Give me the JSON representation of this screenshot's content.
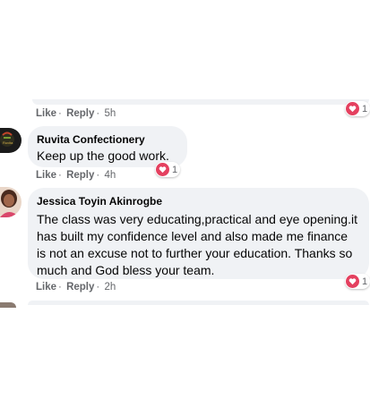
{
  "comments": [
    {
      "meta": {
        "like": "Like",
        "dot": "·",
        "reply": "Reply",
        "sep": "·",
        "time": "5h"
      },
      "reaction_count": "1"
    },
    {
      "author": "Ruvita Confectionery",
      "text": "Keep up the good work.",
      "meta": {
        "like": "Like",
        "dot": "·",
        "reply": "Reply",
        "sep": "·",
        "time": "4h"
      },
      "reaction_count": "1"
    },
    {
      "author": "Jessica Toyin Akinrogbe",
      "text": "The class was very educating,practical and eye opening.it has built my confidence level and also made me finance is not an excuse not to further your education. Thanks so much and God bless your team.",
      "meta": {
        "like": "Like",
        "dot": "·",
        "reply": "Reply",
        "sep": "·",
        "time": "2h"
      },
      "reaction_count": "1"
    }
  ],
  "colors": {
    "bubble": "#f0f2f5",
    "heart": "#e4405f",
    "meta": "#65676b"
  },
  "icons": [
    "heart-reaction-icon",
    "avatar"
  ]
}
